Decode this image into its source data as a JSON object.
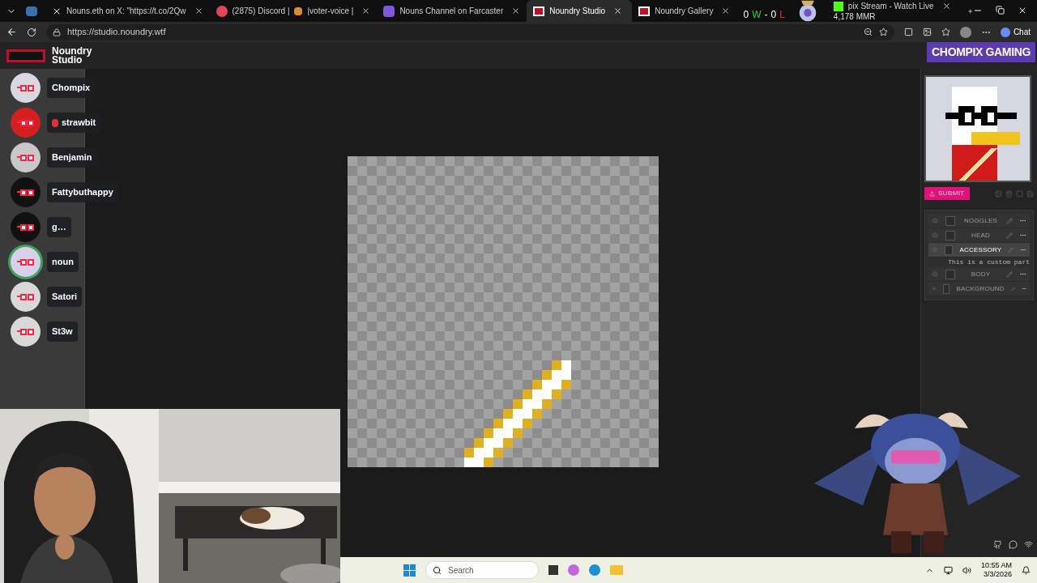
{
  "tabs": [
    {
      "kind": "x",
      "label": "Nouns.eth on X: \"https://t.co/2Qw",
      "selected": false
    },
    {
      "kind": "discord",
      "label": "(2875) Discord |",
      "label_2": "|voter-voice |",
      "selected": false
    },
    {
      "kind": "farcaster",
      "label": "Nouns Channel on Farcaster",
      "selected": false
    },
    {
      "kind": "noundry",
      "label": "Noundry Studio",
      "selected": true
    },
    {
      "kind": "noundry",
      "label": "Noundry Gallery",
      "selected": false
    },
    {
      "kind": "kick",
      "label": "pix Stream - Watch Live",
      "selected": false
    }
  ],
  "address_bar": {
    "url": "https://studio.noundry.wtf",
    "chat_button": "Chat"
  },
  "stream_overlay": {
    "wins": "0",
    "win_letter": "W",
    "sep": "-",
    "losses": "0",
    "loss_letter": "L",
    "mmr": "4,178 MMR",
    "banner": "CHOMPIX GAMING"
  },
  "app": {
    "logo_line_1": "Noundry",
    "logo_line_2": "Studio"
  },
  "voice_users": [
    {
      "name": "Chompix",
      "color": "#d8d8e0",
      "speaking": false
    },
    {
      "name": "strawbit",
      "color": "#d42020",
      "speaking": false,
      "kind": "strawberry"
    },
    {
      "name": "Benjamin",
      "color": "#c8c8c8",
      "speaking": false
    },
    {
      "name": "Fattybuthappy",
      "color": "#111111",
      "speaking": false
    },
    {
      "name": "g…",
      "color": "#111111",
      "speaking": false
    },
    {
      "name": "noun",
      "color": "#d8d0e8",
      "speaking": true
    },
    {
      "name": "Satori",
      "color": "#d8d8d8",
      "speaking": false
    },
    {
      "name": "St3w",
      "color": "#d8d8d8",
      "speaking": false
    }
  ],
  "right_panel": {
    "submit": "SUBMIT",
    "tooltip": "This is a custom part",
    "layers": [
      {
        "name": "NOGGLES",
        "selected": false
      },
      {
        "name": "HEAD",
        "selected": false
      },
      {
        "name": "ACCESSORY",
        "selected": true
      },
      {
        "name": "BODY",
        "selected": false
      },
      {
        "name": "BACKGROUND",
        "selected": false
      }
    ]
  },
  "taskbar": {
    "search_placeholder": "Search",
    "time": "10:55 AM",
    "date": "3/3/2026"
  }
}
